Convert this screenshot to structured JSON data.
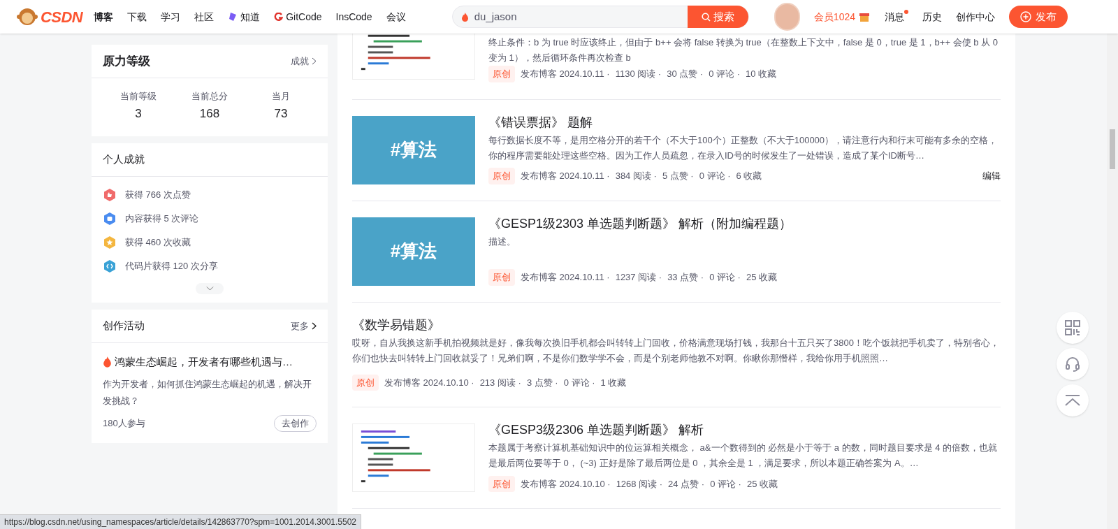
{
  "header": {
    "logo": "CSDN",
    "nav": [
      {
        "label": "博客",
        "kind": "plain",
        "selected": true
      },
      {
        "label": "下载",
        "kind": "plain",
        "selected": false
      },
      {
        "label": "学习",
        "kind": "plain",
        "selected": false
      },
      {
        "label": "社区",
        "kind": "plain",
        "selected": false
      },
      {
        "label": "知道",
        "kind": "zhidao",
        "selected": false
      },
      {
        "label": "GitCode",
        "kind": "gitcode",
        "selected": false
      },
      {
        "label": "InsCode",
        "kind": "plain",
        "selected": false
      },
      {
        "label": "会议",
        "kind": "plain",
        "selected": false
      }
    ],
    "search": {
      "value": "du_jason",
      "button": "搜索"
    },
    "vip": "会员1024",
    "links": [
      {
        "label": "消息",
        "unread": true
      },
      {
        "label": "历史",
        "unread": false
      },
      {
        "label": "创作中心",
        "unread": false
      }
    ],
    "publish": "发布"
  },
  "level_card": {
    "title": "原力等级",
    "link": "成就",
    "stats": [
      {
        "label": "当前等级",
        "value": "3"
      },
      {
        "label": "当前总分",
        "value": "168"
      },
      {
        "label": "当月",
        "value": "73"
      }
    ]
  },
  "achievements_card": {
    "title": "个人成就",
    "items": [
      {
        "text": "获得 766 次点赞",
        "kind": "like",
        "color": "#f06b6b"
      },
      {
        "text": "内容获得 5 次评论",
        "kind": "comment",
        "color": "#4a8cf0"
      },
      {
        "text": "获得 460 次收藏",
        "kind": "favorite",
        "color": "#f4b63f"
      },
      {
        "text": "代码片获得 120 次分享",
        "kind": "code",
        "color": "#3aa2d6"
      }
    ]
  },
  "activity_card": {
    "title": "创作活动",
    "link": "更多",
    "topic": "鸿蒙生态崛起，开发者有哪些机遇与…",
    "desc": "作为开发者，如何抓住鸿蒙生态崛起的机遇，解决开发挑战？",
    "count": "180人参与",
    "button": "去创作"
  },
  "articles": [
    {
      "thumb": {
        "kind": "code"
      },
      "desc": "终止条件：b 为 true 时应该终止，但由于 b++ 会将 false 转换为 true（在整数上下文中，false 是 0，true 是 1，b++ 会使 b 从 0 变为 1），然后循环条件再次检查 b",
      "tag": "原创",
      "meta": [
        "发布博客 2024.10.11 ·",
        "1130 阅读 ·",
        "30 点赞 ·",
        "0 评论 ·",
        "10 收藏"
      ]
    },
    {
      "thumb": {
        "kind": "tag",
        "text": "#算法"
      },
      "title": "《错误票据》 题解",
      "desc": "每行数据长度不等，是用空格分开的若干个（不大于100个）正整数（不大于100000），请注意行内和行末可能有多余的空格，你的程序需要能处理这些空格。因为工作人员疏忽，在录入ID号的时候发生了一处错误，造成了某个ID断号…",
      "tag": "原创",
      "meta": [
        "发布博客 2024.10.11 ·",
        "384 阅读 ·",
        "5 点赞 ·",
        "0 评论 ·",
        "6 收藏"
      ],
      "edit": "编辑"
    },
    {
      "thumb": {
        "kind": "tag",
        "text": "#算法"
      },
      "title": "《GESP1级2303 单选题判断题》 解析（附加编程题）",
      "desc": "描述。",
      "tag": "原创",
      "meta": [
        "发布博客 2024.10.11 ·",
        "1237 阅读 ·",
        "33 点赞 ·",
        "0 评论 ·",
        "25 收藏"
      ]
    },
    {
      "title": "《数学易错题》",
      "desc": "哎呀，自从我换这新手机拍视频就是好，像我每次换旧手机都会叫转转上门回收，价格满意现场打钱，我那台十五只买了3800！吃个饭就把手机卖了，特别省心，你们也快去叫转转上门回收就妥了！兄弟们啊，不是你们数学学不会，而是个别老师他教不对啊。你瞅你那憯样，我给你用手机照照…",
      "tag": "原创",
      "meta": [
        "发布博客 2024.10.10 ·",
        "213 阅读 ·",
        "3 点赞 ·",
        "0 评论 ·",
        "1 收藏"
      ]
    },
    {
      "thumb": {
        "kind": "code"
      },
      "title": "《GESP3级2306 单选题判断题》 解析",
      "desc": "本题属于考察计算机基础知识中的位运算相关概念， a&一个数得到的 必然是小于等于 a 的数，同时题目要求是 4 的倍数，也就是最后两位要等于 0， (~3) 正好是除了最后两位是 0 ，其余全是 1 ，满足要求，所以本题正确答案为 A。…",
      "tag": "原创",
      "meta": [
        "发布博客 2024.10.10 ·",
        "1268 阅读 ·",
        "24 点赞 ·",
        "0 评论 ·",
        "25 收藏"
      ]
    }
  ],
  "status_bar": "https://blog.csdn.net/using_namespaces/article/details/142863770?spm=1001.2014.3001.5502"
}
